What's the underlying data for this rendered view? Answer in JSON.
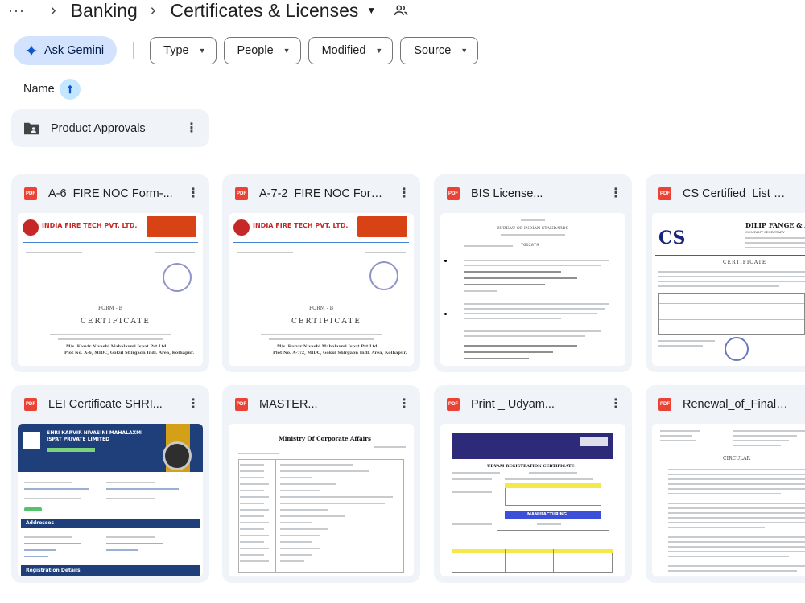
{
  "breadcrumb": {
    "overflow": "···",
    "items": [
      "Banking",
      "Certificates & Licenses"
    ]
  },
  "filters": {
    "gemini_label": "Ask Gemini",
    "chips": [
      "Type",
      "People",
      "Modified",
      "Source"
    ]
  },
  "sort": {
    "label": "Name"
  },
  "folder": {
    "name": "Product Approvals"
  },
  "files": [
    {
      "title": "A-6_FIRE NOC Form-...",
      "type": "PDF",
      "thumb": {
        "company": "INDIA FIRE TECH PVT. LTD.",
        "form": "FORM - B",
        "heading": "CERTIFICATE",
        "addressee": "M/s. Karvir Nivashi Mahalaxmi Ispat Pvt Ltd.",
        "plot": "Plot No. A-6, MIDC, Gokul Shirgaon Indl. Area, Kolhapur."
      }
    },
    {
      "title": "A-7-2_FIRE NOC Form-...",
      "type": "PDF",
      "thumb": {
        "company": "INDIA FIRE TECH PVT. LTD.",
        "form": "FORM - B",
        "heading": "CERTIFICATE",
        "addressee": "M/s. Karvir Nivashi Mahalaxmi Ispat Pvt Ltd.",
        "plot": "Plot No. A-7/2, MIDC, Gokul Shirgaon Indl. Area, Kolhapur."
      }
    },
    {
      "title": "BIS License...",
      "type": "PDF",
      "thumb": {
        "org": "BUREAU OF INDIAN STANDARDS",
        "license": "7602879"
      }
    },
    {
      "title": "CS Certified_List of...",
      "type": "PDF",
      "thumb": {
        "firm": "DILIP FANGE & ASS",
        "role": "COMPANY SECRETARY",
        "heading": "CERTIFICATE"
      }
    },
    {
      "title": "LEI Certificate SHRI...",
      "type": "PDF",
      "thumb": {
        "company": "SHRI KARVIR NIVASINI MAHALAXMI ISPAT PRIVATE LIMITED",
        "section1": "Addresses",
        "section2": "Registration Details",
        "status": "ACTIVE"
      }
    },
    {
      "title": "MASTER...",
      "type": "PDF",
      "thumb": {
        "heading": "Ministry Of Corporate Affairs"
      }
    },
    {
      "title": "Print _ Udyam...",
      "type": "PDF",
      "thumb": {
        "heading": "UDYAM REGISTRATION CERTIFICATE",
        "band": "MANUFACTURING"
      }
    },
    {
      "title": "Renewal_of_Final_Fire_...",
      "type": "PDF",
      "thumb": {
        "heading": "CIRCULAR"
      }
    }
  ],
  "colors": {
    "accent": "#d3e3fd",
    "card_bg": "#f0f4f9",
    "pdf_red": "#ea4335",
    "sort_bg": "#c2e7ff"
  },
  "icons": [
    "people-icon",
    "gemini-sparkle-icon",
    "arrow-up-icon",
    "folder-shared-icon",
    "pdf-icon",
    "more-vert-icon"
  ]
}
